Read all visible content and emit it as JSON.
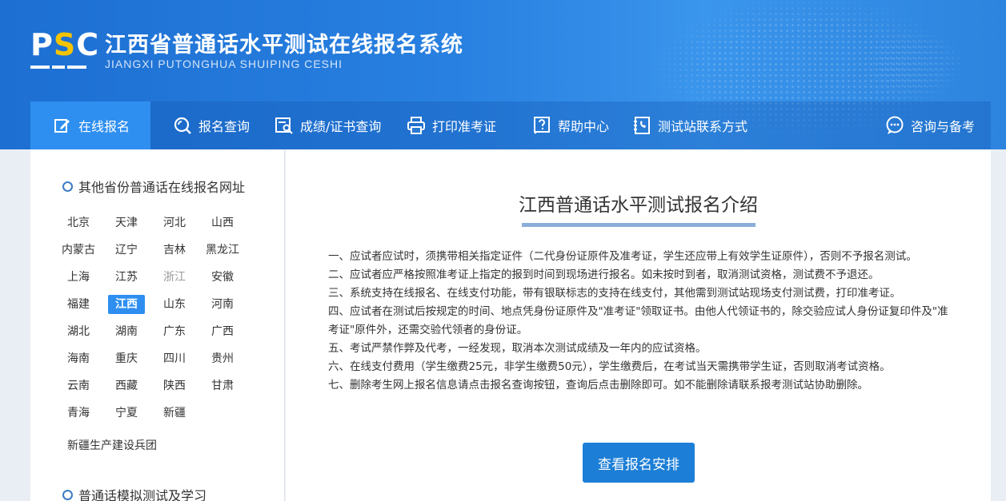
{
  "header": {
    "logo_text_p": "P",
    "logo_text_s": "S",
    "logo_text_c": "C",
    "title": "江西省普通话水平测试在线报名系统",
    "subtitle": "JIANGXI PUTONGHUA SHUIPING CESHI"
  },
  "nav": {
    "items": [
      {
        "label": "在线报名",
        "icon": "edit-icon"
      },
      {
        "label": "报名查询",
        "icon": "search-icon"
      },
      {
        "label": "成绩/证书查询",
        "icon": "certificate-search-icon"
      },
      {
        "label": "打印准考证",
        "icon": "printer-icon"
      },
      {
        "label": "帮助中心",
        "icon": "help-icon"
      },
      {
        "label": "测试站联系方式",
        "icon": "phone-book-icon"
      },
      {
        "label": "咨询与备考",
        "icon": "chat-icon"
      }
    ]
  },
  "sidebar": {
    "section1_title": "其他省份普通话在线报名网址",
    "provinces": [
      "北京",
      "天津",
      "河北",
      "山西",
      "内蒙古",
      "辽宁",
      "吉林",
      "黑龙江",
      "上海",
      "江苏",
      "浙江",
      "安徽",
      "福建",
      "江西",
      "山东",
      "河南",
      "湖北",
      "湖南",
      "广东",
      "广西",
      "海南",
      "重庆",
      "四川",
      "贵州",
      "云南",
      "西藏",
      "陕西",
      "甘肃",
      "青海",
      "宁夏",
      "新疆"
    ],
    "selected": "江西",
    "bingtuan": "新疆生产建设兵团",
    "section2_title": "普通话模拟测试及学习"
  },
  "main": {
    "title": "江西普通话水平测试报名介绍",
    "rules": [
      "一、应试者应试时，须携带相关指定证件（二代身份证原件及准考证，学生还应带上有效学生证原件），否则不予报名测试。",
      "二、应试者应严格按照准考证上指定的报到时间到现场进行报名。如未按时到者，取消测试资格，测试费不予退还。",
      "三、系统支持在线报名、在线支付功能，带有银联标志的支持在线支付，其他需到测试站现场支付测试费，打印准考证。",
      "四、应试者在测试后按规定的时间、地点凭身份证原件及\"准考证\"领取证书。由他人代领证书的，除交验应试人身份证复印件及\"准考证\"原件外，还需交验代领者的身份证。",
      "五、考试严禁作弊及代考，一经发现，取消本次测试成绩及一年内的应试资格。",
      "六、在线支付费用（学生缴费25元，非学生缴费50元），学生缴费后，在考试当天需携带学生证，否则取消考试资格。",
      "七、删除考生网上报名信息请点击报名查询按钮，查询后点击删除即可。如不能删除请联系报考测试站协助删除。"
    ],
    "button_label": "查看报名安排"
  }
}
